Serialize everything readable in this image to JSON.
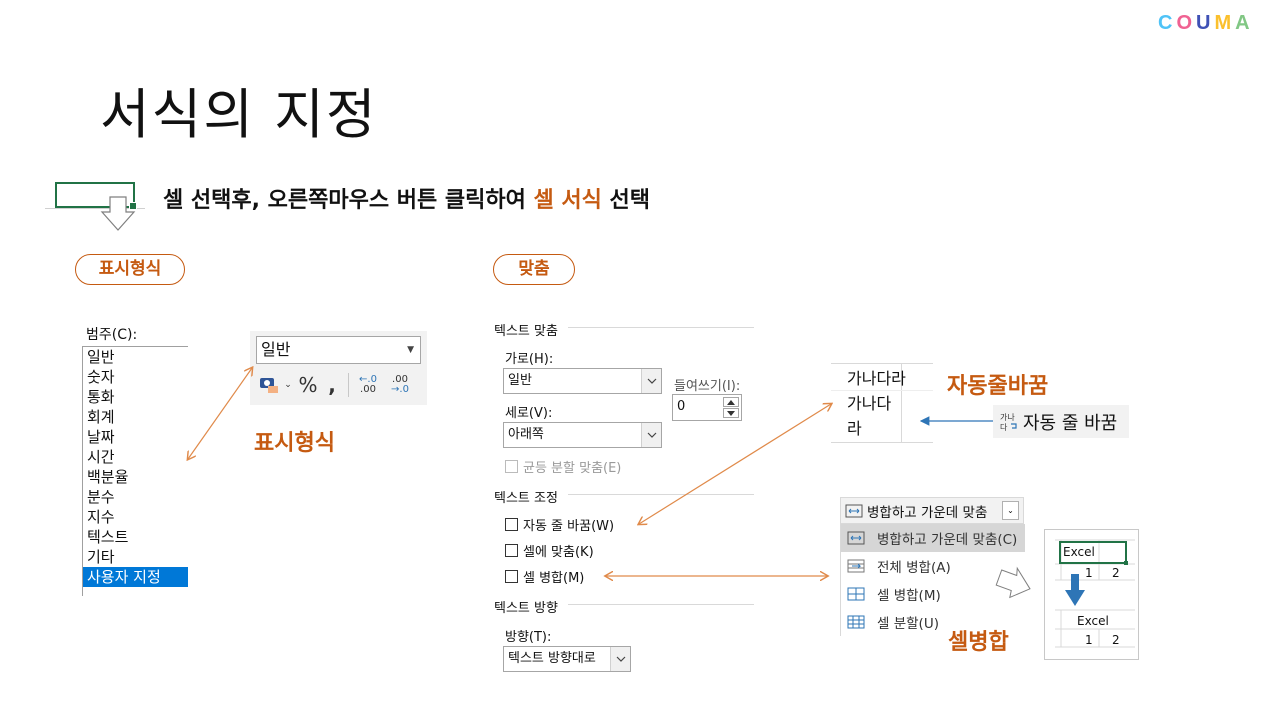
{
  "brand": {
    "letters": [
      {
        "ch": "C",
        "color": "#4fc3f7"
      },
      {
        "ch": "O",
        "color": "#f06292"
      },
      {
        "ch": "U",
        "color": "#3f51b5"
      },
      {
        "ch": "M",
        "color": "#fbc02d"
      },
      {
        "ch": "A",
        "color": "#81c784"
      }
    ]
  },
  "title": "서식의 지정",
  "instruction": {
    "before": "셀 선택후, 오른쪽마우스 버튼 클릭하여 ",
    "highlight": "셀 서식",
    "after": " 선택"
  },
  "pills": {
    "number_format": "표시형식",
    "alignment": "맞춤"
  },
  "category": {
    "label": "범주(C):",
    "items": [
      "일반",
      "숫자",
      "통화",
      "회계",
      "날짜",
      "시간",
      "백분율",
      "분수",
      "지수",
      "텍스트",
      "기타",
      "사용자 지정"
    ],
    "selected": "사용자 지정"
  },
  "number_toolbar": {
    "format_value": "일반",
    "percent": "%",
    "comma": ",",
    "inc_decimal_top": "←.0",
    "inc_decimal_bottom": ".00",
    "dec_decimal_top": ".00",
    "dec_decimal_bottom": "→.0"
  },
  "labels": {
    "number_format": "표시형식",
    "wrap": "자동줄바꿈",
    "merge": "셀병합"
  },
  "alignment_dialog": {
    "text_alignment_title": "텍스트 맞춤",
    "horizontal_label": "가로(H):",
    "horizontal_value": "일반",
    "indent_label": "들여쓰기(I):",
    "indent_value": "0",
    "vertical_label": "세로(V):",
    "vertical_value": "아래쪽",
    "justify_distributed": "균등 분할 맞춤(E)",
    "text_control_title": "텍스트 조정",
    "wrap_text": "자동 줄 바꿈(W)",
    "shrink_to_fit": "셀에 맞춤(K)",
    "merge_cells": "셀 병합(M)",
    "direction_title": "텍스트 방향",
    "direction_label": "방향(T):",
    "direction_value": "텍스트 방향대로"
  },
  "wrap_demo": {
    "lines": [
      "가나다라",
      "가나다",
      "라"
    ],
    "button_label": "자동 줄 바꿈"
  },
  "merge_menu": {
    "top_label": "병합하고 가운데 맞춤",
    "items": [
      {
        "label": "병합하고 가운데 맞춤(C)",
        "active": true
      },
      {
        "label": "전체 병합(A)",
        "active": false
      },
      {
        "label": "셀 병합(M)",
        "active": false
      },
      {
        "label": "셀 분할(U)",
        "active": false
      }
    ]
  },
  "excel_demo": {
    "before_text": "Excel",
    "before_values": [
      "1",
      "2"
    ],
    "after_text": "Excel",
    "after_values": [
      "1",
      "2"
    ]
  },
  "colors": {
    "accent": "#c55a11",
    "excel_green": "#217346",
    "selection_blue": "#0078d7",
    "arrow_blue": "#2e75b6"
  }
}
